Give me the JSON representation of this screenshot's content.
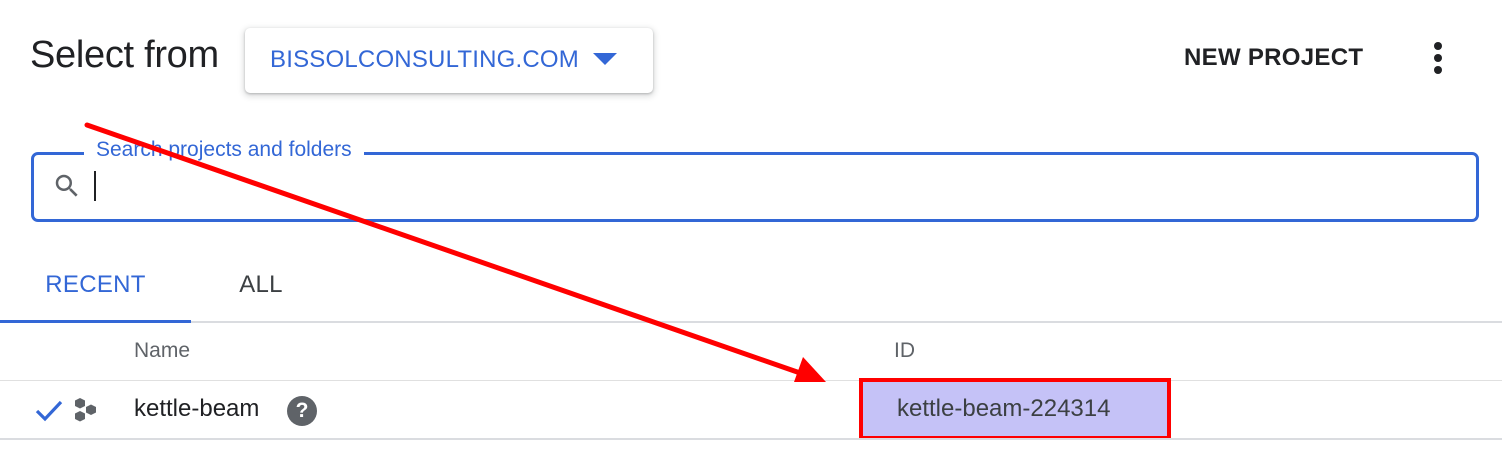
{
  "header": {
    "title": "Select from",
    "organization": "BISSOLCONSULTING.COM",
    "new_project_label": "NEW PROJECT"
  },
  "search": {
    "legend": "Search projects and folders",
    "value": "",
    "placeholder": ""
  },
  "tabs": [
    {
      "label": "RECENT",
      "active": true
    },
    {
      "label": "ALL",
      "active": false
    }
  ],
  "table": {
    "columns": [
      "Name",
      "ID"
    ],
    "rows": [
      {
        "selected": true,
        "name": "kettle-beam",
        "id": "kettle-beam-224314"
      }
    ]
  },
  "icons": {
    "org_dropdown": "caret-down-icon",
    "menu": "more-vert-icon",
    "search": "search-icon",
    "selected": "check-icon",
    "project": "project-hexagons-icon",
    "help": "help-icon"
  },
  "colors": {
    "accent": "#3367d6",
    "annotation": "#ff0000",
    "highlight_fill": "#c5c2f7"
  }
}
